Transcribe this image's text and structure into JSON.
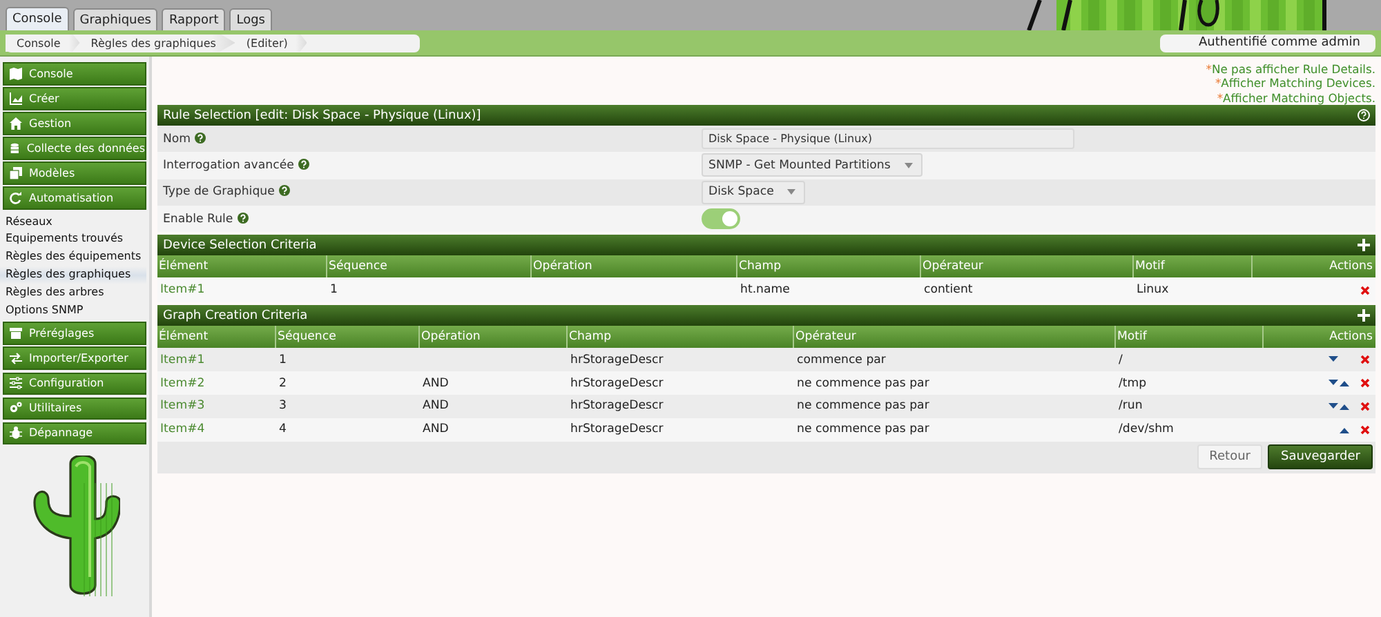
{
  "top_tabs": [
    {
      "label": "Console",
      "selected": true
    },
    {
      "label": "Graphiques",
      "selected": false
    },
    {
      "label": "Rapport",
      "selected": false
    },
    {
      "label": "Logs",
      "selected": false
    }
  ],
  "breadcrumbs": [
    "Console",
    "Règles des graphiques",
    "(Editer)"
  ],
  "user_menu": {
    "label": "Authentifié comme admin"
  },
  "sidebar": {
    "items": [
      {
        "label": "Console"
      },
      {
        "label": "Créer"
      },
      {
        "label": "Gestion"
      },
      {
        "label": "Collecte des données"
      },
      {
        "label": "Modèles"
      },
      {
        "label": "Automatisation",
        "children": [
          {
            "label": "Réseaux",
            "selected": false
          },
          {
            "label": "Equipements trouvés",
            "selected": false
          },
          {
            "label": "Règles des équipements",
            "selected": false
          },
          {
            "label": "Règles des graphiques",
            "selected": true
          },
          {
            "label": "Règles des arbres",
            "selected": false
          },
          {
            "label": "Options SNMP",
            "selected": false
          }
        ]
      },
      {
        "label": "Préréglages"
      },
      {
        "label": "Importer/Exporter"
      },
      {
        "label": "Configuration"
      },
      {
        "label": "Utilitaires"
      },
      {
        "label": "Dépannage"
      }
    ]
  },
  "links": [
    {
      "marker": "*",
      "label": "Ne pas afficher Rule Details."
    },
    {
      "marker": "*",
      "label": "Afficher Matching Devices."
    },
    {
      "marker": "*",
      "label": "Afficher Matching Objects."
    }
  ],
  "rule": {
    "title": "Rule Selection [edit: Disk Space - Physique (Linux)]",
    "fields": [
      {
        "kind": "text",
        "label": "Nom",
        "value": "Disk Space - Physique (Linux)"
      },
      {
        "kind": "select",
        "label": "Interrogation avancée",
        "value": "SNMP - Get Mounted Partitions"
      },
      {
        "kind": "select",
        "label": "Type de Graphique",
        "value": "Disk Space"
      },
      {
        "kind": "toggle",
        "label": "Enable Rule",
        "on": true
      }
    ]
  },
  "device_criteria": {
    "title": "Device Selection Criteria",
    "columns": [
      "Élément",
      "Séquence",
      "Opération",
      "Champ",
      "Opérateur",
      "Motif",
      "Actions"
    ],
    "rows": [
      {
        "element": "Item#1",
        "sequence": "1",
        "field": "ht.name",
        "operator": "contient",
        "pattern": "Linux",
        "can_move_down": false,
        "can_move_up": false
      }
    ]
  },
  "graph_criteria": {
    "title": "Graph Creation Criteria",
    "columns": [
      "Élément",
      "Séquence",
      "Opération",
      "Champ",
      "Opérateur",
      "Motif",
      "Actions"
    ],
    "rows": [
      {
        "element": "Item#1",
        "sequence": "1",
        "field": "hrStorageDescr",
        "operator": "commence par",
        "pattern": "/",
        "can_move_down": true,
        "can_move_up": false
      },
      {
        "element": "Item#2",
        "sequence": "2",
        "operation": "AND",
        "field": "hrStorageDescr",
        "operator": "ne commence pas par",
        "pattern": "/tmp",
        "can_move_down": true,
        "can_move_up": true
      },
      {
        "element": "Item#3",
        "sequence": "3",
        "operation": "AND",
        "field": "hrStorageDescr",
        "operator": "ne commence pas par",
        "pattern": "/run",
        "can_move_down": true,
        "can_move_up": true
      },
      {
        "element": "Item#4",
        "sequence": "4",
        "operation": "AND",
        "field": "hrStorageDescr",
        "operator": "ne commence pas par",
        "pattern": "/dev/shm",
        "can_move_down": false,
        "can_move_up": true
      }
    ]
  },
  "buttons": [
    {
      "kind": "secondary",
      "label": "Retour"
    },
    {
      "kind": "primary",
      "label": "Sauvegarder"
    }
  ]
}
